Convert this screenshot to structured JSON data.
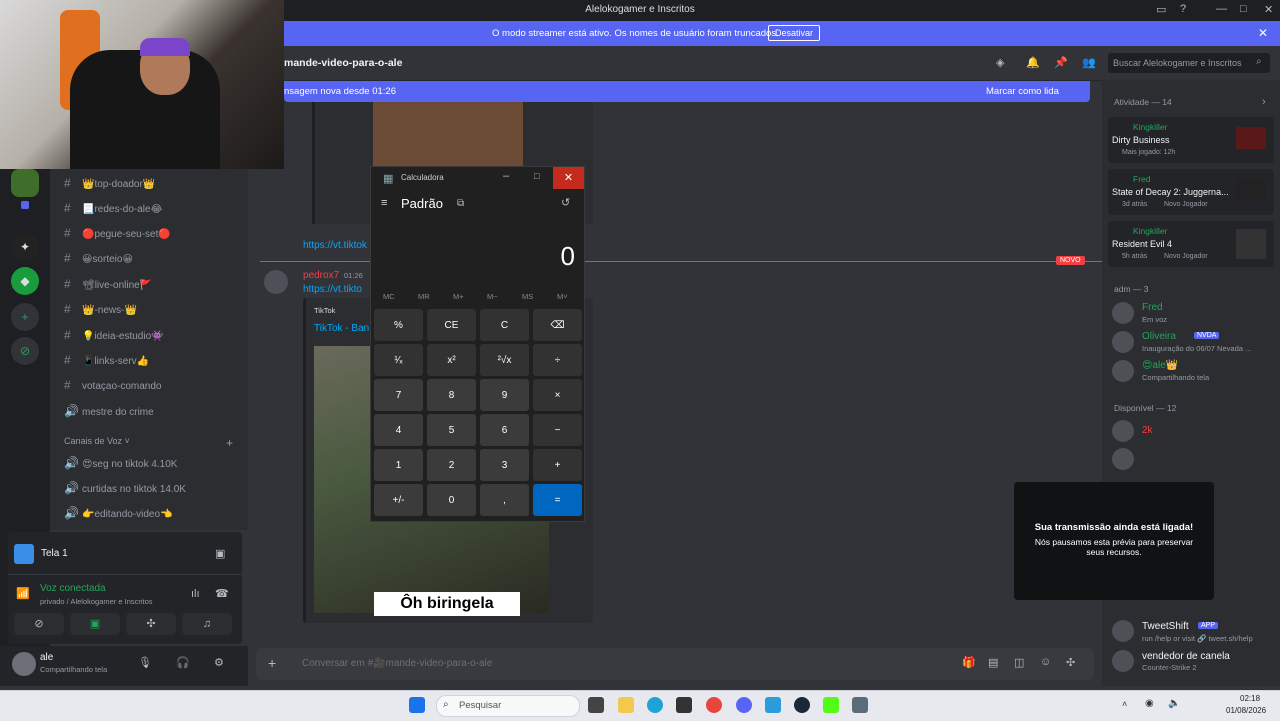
{
  "window": {
    "title": "Alelokogamer e Inscritos"
  },
  "streamer_banner": {
    "message": "O modo streamer está ativo. Os nomes de usuário foram truncados.",
    "button": "Desativar"
  },
  "channel_header": {
    "name": "mande-video-para-o-ale",
    "search_placeholder": "Buscar Alelokogamer e Inscritos"
  },
  "new_messages_bar": {
    "text": "nsagem nova desde 01:26",
    "action": "Marcar como lida"
  },
  "channels": {
    "text": [
      "👑top-doador👑",
      "📃redes-do-ale😂",
      "🔴pegue-seu-set🔴",
      "😀sorteio😀",
      "📽live-online🚩",
      "👑-news-👑",
      "💡ideia-estudio👾",
      "📱links-serv👍",
      "votaçao-comando",
      "mestre do crime"
    ],
    "voice_category": "Canais de Voz",
    "voice": [
      "😍seg no tiktok 4.10K",
      "curtidas no tiktok 14.0K",
      "👉editando-video👈"
    ]
  },
  "voice_panel": {
    "screen_label": "Tela 1",
    "status": "Voz conectada",
    "detail": "privado / Alelokogamer e Inscritos"
  },
  "user_bar": {
    "name": "ale",
    "status": "Compartilhando tela"
  },
  "messages": {
    "link1": "https://vt.tiktok",
    "author": "pedrox7",
    "time": "01:26",
    "link2": "https://vt.tikto",
    "embed_provider": "TikTok",
    "embed_title": "TikTok - Ban",
    "video_caption": "Ôh biringela",
    "new_label": "NOVO"
  },
  "composer": {
    "placeholder": "Conversar em #🎥mande-video-para-o-ale"
  },
  "members": {
    "activity_header": "Atividade — 14",
    "activities": [
      {
        "user": "Kingkiller",
        "game": "Dirty Business",
        "sub": "Mais jogado: 12h"
      },
      {
        "user": "Fred",
        "game": "State of Decay 2: Juggerna...",
        "sub": "3d atrás",
        "tag": "Novo Jogador"
      },
      {
        "user": "Kingkiller",
        "game": "Resident Evil 4",
        "sub": "5h atrás",
        "tag": "Novo Jogador"
      }
    ],
    "adm_header": "adm — 3",
    "adm": [
      {
        "name": "Fred",
        "status": "Em voz"
      },
      {
        "name": "Oliveira",
        "badge": "NVDA",
        "status": "Inauguração do 06/07 Nevada ..."
      },
      {
        "name": "😍ale👑",
        "status": "Compartilhando tela"
      }
    ],
    "available_header": "Disponível — 12",
    "available": [
      {
        "name": "2k",
        "status": ""
      },
      {
        "name": "",
        "status": ""
      }
    ],
    "bottom": [
      {
        "name": "TweetShift",
        "badge": "APP",
        "status": "run /help or visit 🔗 tweet.sh/help"
      },
      {
        "name": "vendedor de canela",
        "status": "Counter-Strike 2"
      }
    ]
  },
  "stream_overlay": {
    "title": "Sua transmissão ainda está ligada!",
    "body": "Nós pausamos esta prévia para preservar seus recursos."
  },
  "calculator": {
    "title": "Calculadora",
    "mode": "Padrão",
    "display": "0",
    "memory": [
      "MC",
      "MR",
      "M+",
      "M−",
      "MS",
      "M˅"
    ],
    "keys": [
      [
        "%",
        "CE",
        "C",
        "⌫"
      ],
      [
        "¹⁄ₓ",
        "x²",
        "²√x",
        "÷"
      ],
      [
        "7",
        "8",
        "9",
        "×"
      ],
      [
        "4",
        "5",
        "6",
        "−"
      ],
      [
        "1",
        "2",
        "3",
        "+"
      ],
      [
        "+/-",
        "0",
        ",",
        "="
      ]
    ]
  },
  "taskbar": {
    "search": "Pesquisar",
    "time": "02:18",
    "date": "01/08/2026"
  },
  "colors": {
    "accent": "#5865f2",
    "green": "#23a55a",
    "calc_equals": "#0067c0",
    "close_red": "#c42b1c"
  }
}
